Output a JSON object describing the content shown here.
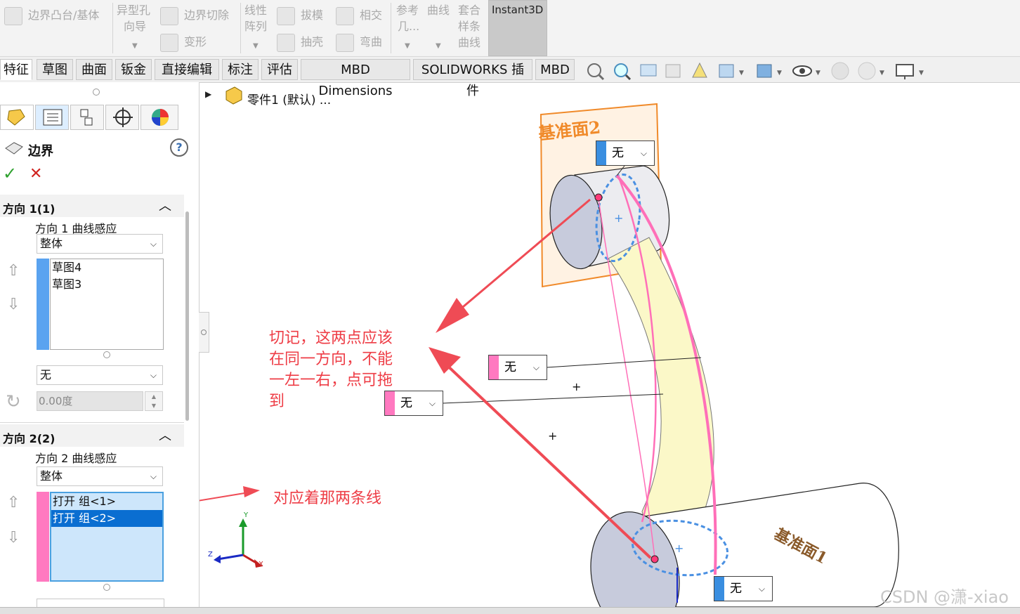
{
  "ribbon": {
    "boundary_boss": "边界凸台/基体",
    "hole_wizard_1": "异型孔",
    "hole_wizard_2": "向导",
    "boundary_cut": "边界切除",
    "deform": "变形",
    "linear_1": "线性",
    "linear_2": "阵列",
    "draft": "拔模",
    "intersect": "相交",
    "shell": "抽壳",
    "flex": "弯曲",
    "reference_1": "参考",
    "reference_2": "几...",
    "curves": "曲线",
    "fit_spline_1": "套合",
    "fit_spline_2": "样条",
    "fit_spline_3": "曲线",
    "instant3d": "Instant3D"
  },
  "tabs": [
    "特征",
    "草图",
    "曲面",
    "钣金",
    "直接编辑",
    "标注",
    "评估",
    "MBD Dimensions",
    "SOLIDWORKS 插件",
    "MBD"
  ],
  "tree": {
    "part_label": "零件1 (默认) ..."
  },
  "panel": {
    "title": "边界",
    "help": "?",
    "ok": "✓",
    "cancel": "✕",
    "dir1": {
      "header": "方向 1(1)",
      "curve_influence_label": "方向 1 曲线感应",
      "curve_influence_value": "整体",
      "items": [
        "草图4",
        "草图3"
      ],
      "tangent_value": "无",
      "angle_value": "0.00度",
      "color": "#5aa3f0"
    },
    "dir2": {
      "header": "方向 2(2)",
      "curve_influence_label": "方向 2 曲线感应",
      "curve_influence_value": "整体",
      "items": [
        "打开 组<1>",
        "打开 组<2>"
      ],
      "color": "#ff79c0"
    }
  },
  "viewport": {
    "plane2_label": "基准面2",
    "plane1_label": "基准面1",
    "tag_top": "无",
    "tag_mid1": "无",
    "tag_mid2": "无",
    "tag_bottom": "无",
    "note_1_line1": "切记，这两点应该",
    "note_1_line2": "在同一方向，不能",
    "note_1_line3": "一左一右，点可拖",
    "note_1_line4": "到",
    "note_2": "对应着那两条线",
    "axis_x": "X",
    "axis_y": "Y",
    "axis_z": "Z",
    "watermark": "CSDN @潇-xiao"
  }
}
